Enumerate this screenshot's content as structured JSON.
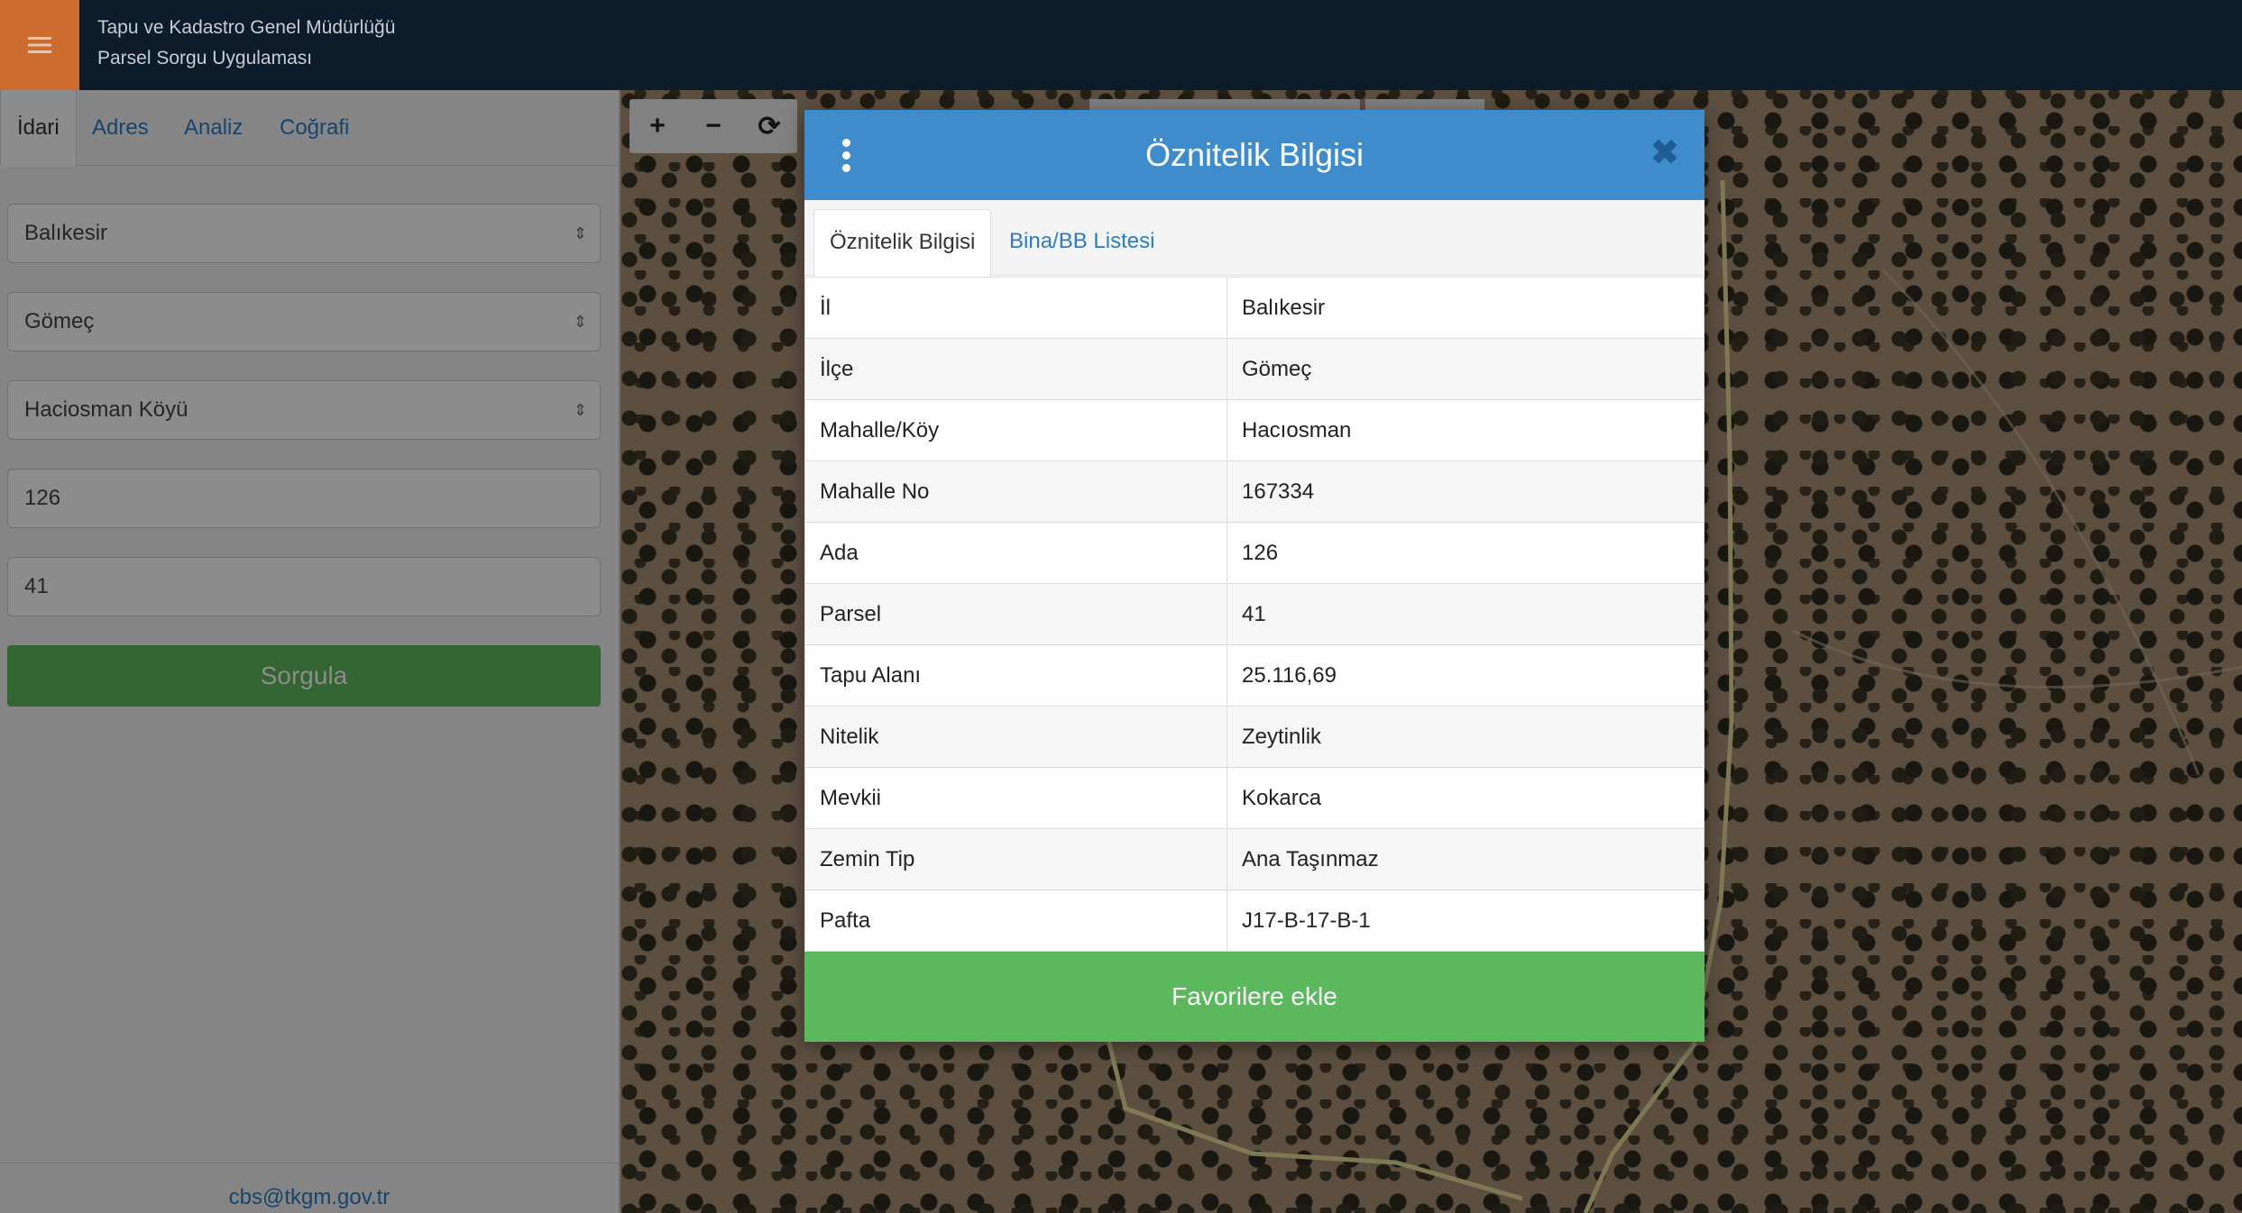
{
  "header": {
    "line1": "Tapu ve Kadastro Genel Müdürlüğü",
    "line2": "Parsel Sorgu Uygulaması",
    "menu_icon": "hamburger-icon",
    "menu_color": "#cd6a2e"
  },
  "sidebar": {
    "tabs": [
      {
        "label": "İdari",
        "active": true
      },
      {
        "label": "Adres"
      },
      {
        "label": "Analiz"
      },
      {
        "label": "Coğrafi"
      }
    ],
    "il": "Balıkesir",
    "ilce": "Gömeç",
    "mahalle": "Haciosman Köyü",
    "ada": "126",
    "parsel": "41",
    "query_button": "Sorgula",
    "footer_email": "cbs@tkgm.gov.tr"
  },
  "map": {
    "tools": [
      {
        "icon": "zoom-in-icon",
        "glyph": "+"
      },
      {
        "icon": "zoom-out-icon",
        "glyph": "−"
      },
      {
        "icon": "refresh-icon",
        "glyph": "⟳"
      }
    ]
  },
  "modal": {
    "title": "Öznitelik Bilgisi",
    "tabs": [
      "Öznitelik Bilgisi",
      "Bina/BB Listesi"
    ],
    "rows": [
      {
        "key": "İl",
        "value": "Balıkesir"
      },
      {
        "key": "İlçe",
        "value": "Gömeç"
      },
      {
        "key": "Mahalle/Köy",
        "value": "Hacıosman"
      },
      {
        "key": "Mahalle No",
        "value": "167334"
      },
      {
        "key": "Ada",
        "value": "126"
      },
      {
        "key": "Parsel",
        "value": "41"
      },
      {
        "key": "Tapu Alanı",
        "value": "25.116,69"
      },
      {
        "key": "Nitelik",
        "value": "Zeytinlik"
      },
      {
        "key": "Mevkii",
        "value": "Kokarca"
      },
      {
        "key": "Zemin Tip",
        "value": "Ana Taşınmaz"
      },
      {
        "key": "Pafta",
        "value": "J17-B-17-B-1"
      }
    ],
    "favorite_button": "Favorilere ekle",
    "header_color": "#3f8ccd",
    "accent_green": "#5cb85c"
  }
}
